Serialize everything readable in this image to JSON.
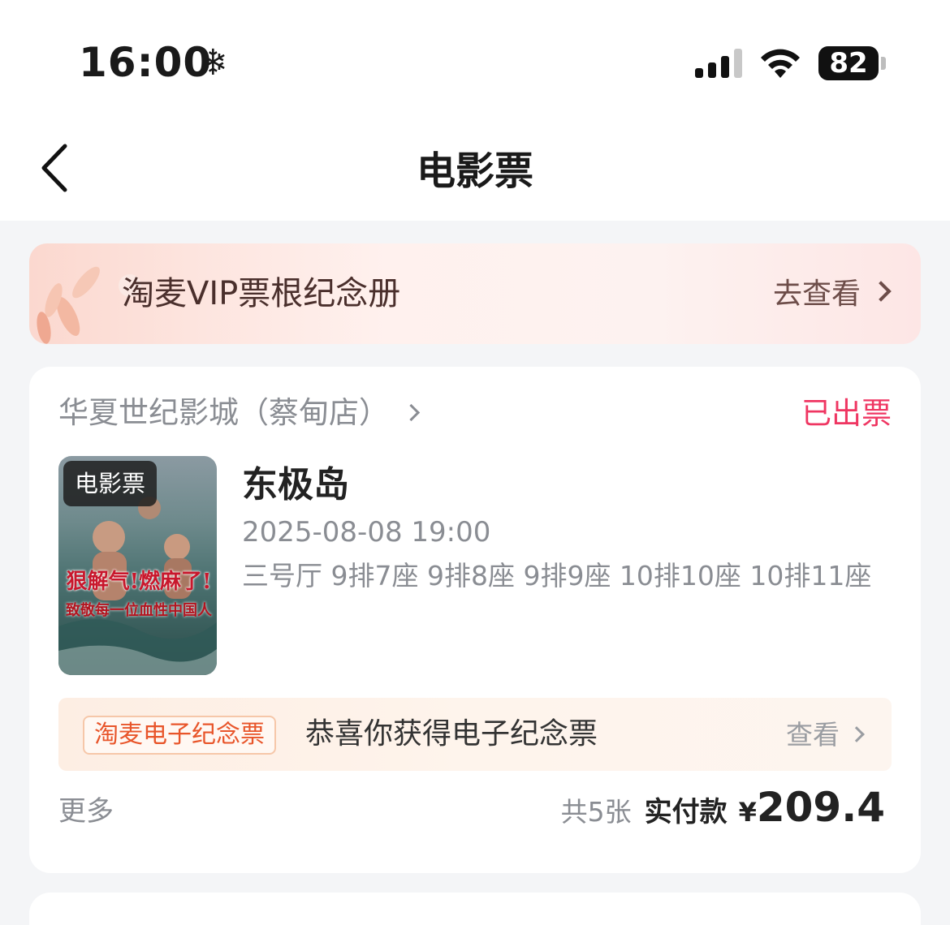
{
  "status_bar": {
    "time": "16:00",
    "battery": "82"
  },
  "nav": {
    "title": "电影票"
  },
  "banner": {
    "text": "淘麦VIP票根纪念册",
    "link": "去查看"
  },
  "order": {
    "cinema": "华夏世纪影城（蔡甸店）",
    "status": "已出票",
    "status_color": "#ef3662",
    "poster_badge": "电影票",
    "poster_slogan": "狠解气!燃麻了!",
    "poster_sub": "致敬每一位血性中国人",
    "movie_name": "东极岛",
    "show_time": "2025-08-08 19:00",
    "seats": "三号厅 9排7座 9排8座 9排9座 10排10座 10排11座",
    "souvenir_tag": "淘麦电子纪念票",
    "souvenir_text": "恭喜你获得电子纪念票",
    "souvenir_link": "查看",
    "more": "更多",
    "ticket_count": "共5张",
    "paid_label": "实付款",
    "currency": "¥",
    "amount": "209.4"
  }
}
